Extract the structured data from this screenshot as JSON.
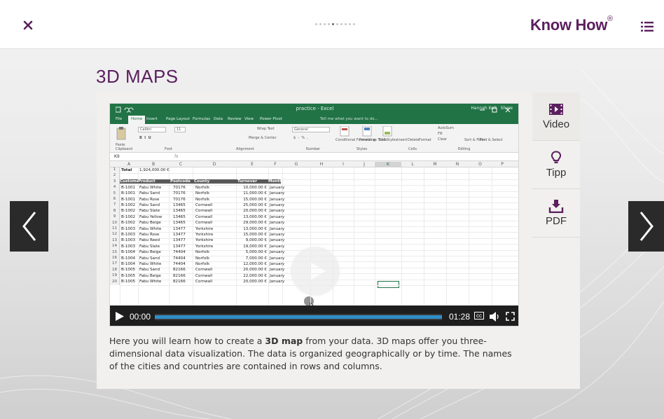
{
  "header": {
    "close_icon": "close-icon",
    "brand": "Know How",
    "brand_mark": "®",
    "menu_icon": "list-menu-icon",
    "progress": {
      "total": 10,
      "current": 5
    }
  },
  "page": {
    "title": "3D MAPS"
  },
  "side_panel": {
    "items": [
      {
        "label": "Video",
        "icon": "film-icon"
      },
      {
        "label": "Tipp",
        "icon": "lightbulb-icon"
      },
      {
        "label": "PDF",
        "icon": "download-icon"
      }
    ]
  },
  "video": {
    "excel": {
      "window_title": "practice - Excel",
      "tell_me": "Tell me what you want to do...",
      "user": "Hannah Kolt",
      "share": "Share",
      "tabs": [
        "File",
        "Home",
        "Insert",
        "Page Layout",
        "Formulas",
        "Data",
        "Review",
        "View",
        "Power Pivot"
      ],
      "ribbon": {
        "font": "Calibri",
        "size": "11",
        "wrap": "Wrap Text",
        "merge": "Merge & Center",
        "format": "General",
        "groups": [
          "Clipboard",
          "Font",
          "Alignment",
          "Number",
          "Styles",
          "Cells",
          "Editing"
        ],
        "styles": [
          "Conditional Formatting",
          "Format as Table",
          "Cell Styles"
        ],
        "cells": [
          "Insert",
          "Delete",
          "Format"
        ],
        "editing": [
          "AutoSum",
          "Fill",
          "Clear",
          "Sort & Filter",
          "Find & Select"
        ],
        "paste": "Paste"
      },
      "name_box": "K9",
      "fx": "fx",
      "columns": [
        "A",
        "B",
        "C",
        "D",
        "E",
        "F",
        "G",
        "H",
        "I",
        "J",
        "K",
        "L",
        "M",
        "N",
        "O",
        "P"
      ],
      "total_label": "Total",
      "total_value": "1,924,000.00 €",
      "headers": [
        "Customer",
        "Product",
        "Postcode",
        "County",
        "Turnover",
        "Month"
      ],
      "rows": [
        [
          "B-1001",
          "Fabu White",
          "70176",
          "Norfolk",
          "10,000.00 €",
          "January"
        ],
        [
          "B-1001",
          "Fabu Sand",
          "70176",
          "Norfolk",
          "11,000.00 €",
          "January"
        ],
        [
          "B-1001",
          "Fabu Rose",
          "70176",
          "Norfolk",
          "15,000.00 €",
          "January"
        ],
        [
          "B-1002",
          "Fabu Sand",
          "13465",
          "Cornwall",
          "25,000.00 €",
          "January"
        ],
        [
          "B-1002",
          "Fabu Slate",
          "13465",
          "Cornwall",
          "20,000.00 €",
          "January"
        ],
        [
          "B-1002",
          "Fabu Yellow",
          "13465",
          "Cornwall",
          "13,000.00 €",
          "January"
        ],
        [
          "B-1002",
          "Fabu Beige",
          "13465",
          "Cornwall",
          "29,000.00 €",
          "January"
        ],
        [
          "B-1003",
          "Fabu White",
          "13477",
          "Yorkshire",
          "13,000.00 €",
          "January"
        ],
        [
          "B-1003",
          "Fabu Rose",
          "13477",
          "Yorkshire",
          "15,000.00 €",
          "January"
        ],
        [
          "B-1003",
          "Fabu Reed",
          "13477",
          "Yorkshire",
          "9,000.00 €",
          "January"
        ],
        [
          "B-1003",
          "Fabu Slate",
          "13477",
          "Yorkshire",
          "19,000.00 €",
          "January"
        ],
        [
          "B-1004",
          "Fabu Beige",
          "74404",
          "Norfolk",
          "5,000.00 €",
          "January"
        ],
        [
          "B-1004",
          "Fabu Sand",
          "74404",
          "Norfolk",
          "7,000.00 €",
          "January"
        ],
        [
          "B-1004",
          "Fabu White",
          "74404",
          "Norfolk",
          "12,000.00 €",
          "January"
        ],
        [
          "B-1005",
          "Fabu Sand",
          "82166",
          "Cornwall",
          "20,000.00 €",
          "January"
        ],
        [
          "B-1005",
          "Fabu Beige",
          "82166",
          "Cornwall",
          "22,000.00 €",
          "January"
        ],
        [
          "B-1005",
          "Fabu White",
          "82166",
          "Cornwall",
          "20,000.00 €",
          "January"
        ]
      ]
    },
    "controls": {
      "current_time": "00:00",
      "duration": "01:28",
      "cc": "cc",
      "play_icon": "play-icon",
      "volume_icon": "volume-icon",
      "fullscreen_icon": "fullscreen-icon"
    }
  },
  "description": {
    "before": "Here you will learn how to create a ",
    "bold": "3D map",
    "after": " from your data. 3D maps offer you three-dimensional data visualization. The data is organized geographically or by time. The names of the cities and countries are contained in rows and columns."
  },
  "navigation": {
    "prev_icon": "chevron-left-icon",
    "next_icon": "chevron-right-icon"
  },
  "colors": {
    "brand": "#5b1f5e",
    "excel_green": "#217346",
    "progress_blue": "#2f8fc8"
  }
}
